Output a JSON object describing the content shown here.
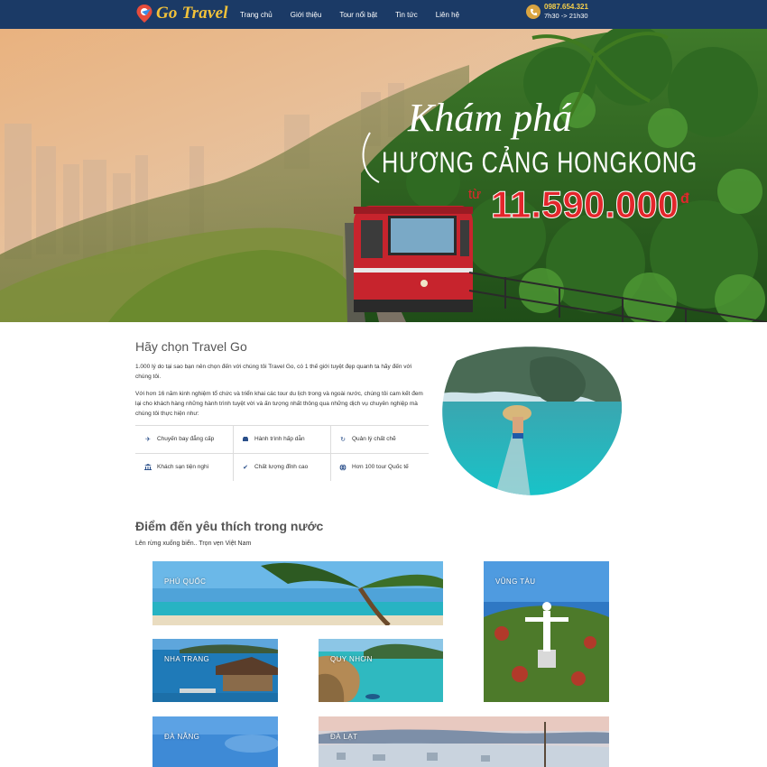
{
  "header": {
    "logo_text": "Go Travel",
    "nav": [
      "Trang chủ",
      "Giới thiệu",
      "Tour nổi bật",
      "Tin tức",
      "Liên hệ"
    ],
    "phone": "0987.654.321",
    "hours": "7h30 -> 21h30",
    "colors": {
      "bar": "#1b3a66",
      "logo": "#f2c23a",
      "phone": "#f7d04a"
    }
  },
  "hero": {
    "script_title": "Khám phá",
    "title": "HƯƠNG CẢNG HONGKONG",
    "price_prefix": "từ",
    "price": "11.590.000",
    "currency": "đ",
    "price_color": "#e3262b"
  },
  "why": {
    "title": "Hãy chọn Travel Go",
    "p1": "1.000 lý do tại sao bạn nên chọn đến với chúng tôi Travel Go, có 1 thế giới tuyệt đẹp quanh ta hãy đến với chúng tôi.",
    "p2": "Với hơn 16 năm kinh nghiệm tổ chức và triển khai các tour du lịch trong và ngoài nước, chúng tôi cam kết đem lại cho khách hàng những hành trình tuyệt vời và ấn tượng nhất thông qua những dịch vụ chuyên nghiệp mà chúng tôi thực hiện như:",
    "features": [
      {
        "icon": "plane-icon",
        "label": "Chuyến bay đẳng cấp"
      },
      {
        "icon": "car-icon",
        "label": "Hành trình hấp dẫn"
      },
      {
        "icon": "refresh-icon",
        "label": "Quản lý chất chẽ"
      },
      {
        "icon": "bank-icon",
        "label": "Khách sạn tiện nghi"
      },
      {
        "icon": "check-icon",
        "label": "Chất lượng đỉnh cao"
      },
      {
        "icon": "globe-icon",
        "label": "Hơn 100 tour Quốc tế"
      }
    ]
  },
  "destinations": {
    "title": "Điểm đến yêu thích trong nước",
    "subtitle": "Lên rừng xuống biển.. Trọn vẹn Việt Nam",
    "tiles": [
      {
        "label": "PHÚ QUỐC"
      },
      {
        "label": "VŨNG TÀU"
      },
      {
        "label": "NHA TRANG"
      },
      {
        "label": "QUY NHƠN"
      },
      {
        "label": "ĐÀ NẴNG"
      },
      {
        "label": "ĐÀ LẠT"
      }
    ]
  }
}
